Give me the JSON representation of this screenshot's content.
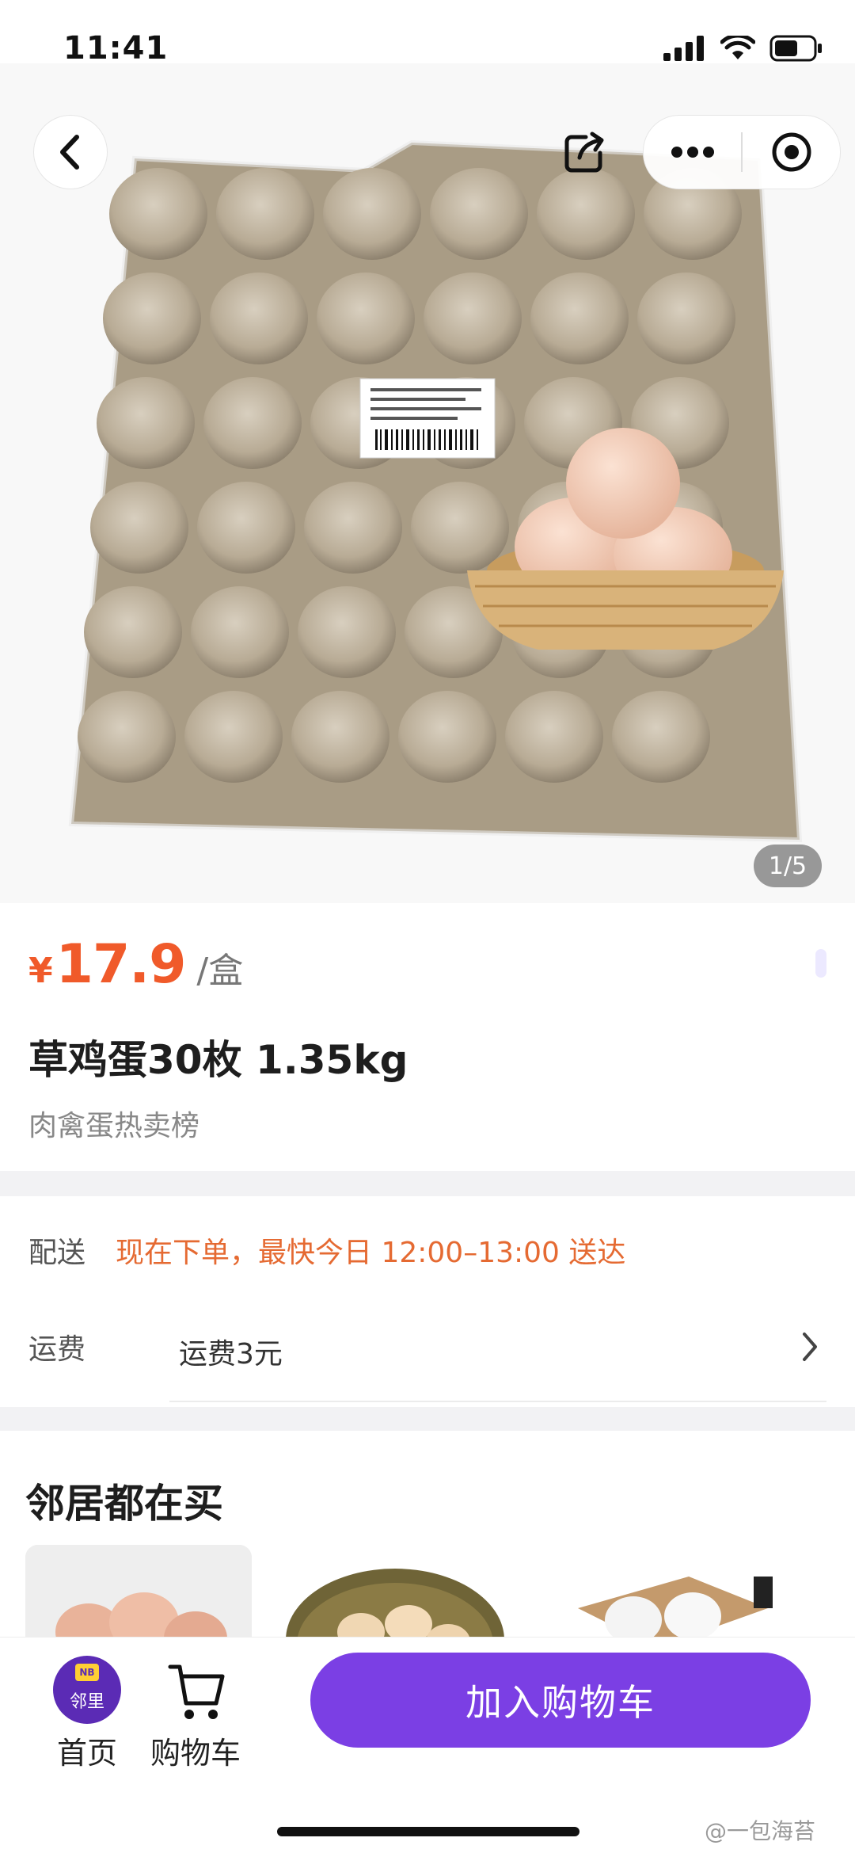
{
  "status_bar": {
    "time": "11:41",
    "icons": [
      "signal-icon",
      "wifi-icon",
      "battery-icon"
    ]
  },
  "nav": {
    "icons": [
      "back-icon",
      "share-icon",
      "more-icon",
      "target-icon"
    ]
  },
  "gallery": {
    "counter": "1/5"
  },
  "product": {
    "price_symbol": "¥",
    "price": "17.9",
    "unit": "/盒",
    "title": "草鸡蛋30枚 1.35kg",
    "category_tag": "肉禽蛋热卖榜"
  },
  "delivery": {
    "label": "配送",
    "text": "现在下单，最快今日 12:00–13:00 送达"
  },
  "shipping": {
    "label": "运费",
    "text": "运费3元"
  },
  "recommend": {
    "title": "邻居都在买"
  },
  "bottom_bar": {
    "home_logo_badge": "NB",
    "home_logo_text": "邻里",
    "home_label": "首页",
    "cart_label": "购物车",
    "add_to_cart": "加入购物车"
  },
  "watermark": "@一包海苔",
  "colors": {
    "price": "#f05a2a",
    "delivery_text": "#e56a32",
    "primary_button": "#7b3fe4",
    "logo": "#5b2bb5"
  }
}
